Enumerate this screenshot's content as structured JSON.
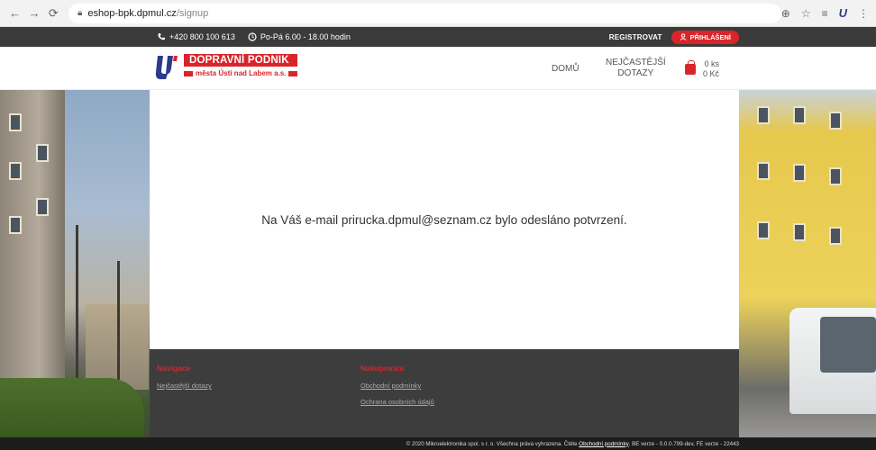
{
  "browser": {
    "url_host": "eshop-bpk.dpmul.cz",
    "url_path": "/signup"
  },
  "topbar": {
    "phone": "+420 800 100 613",
    "hours": "Po-Pá 6.00 - 18.00 hodin",
    "register_label": "REGISTROVAT",
    "login_label": "PŘIHLÁŠENÍ"
  },
  "header": {
    "logo_title": "DOPRAVNÍ PODNIK",
    "logo_subtitle": "města Ústí nad Labem a.s.",
    "nav_home": "DOMŮ",
    "nav_faq_line1": "NEJČASTĚJŠÍ",
    "nav_faq_line2": "DOTAZY",
    "cart_count": "0 ks",
    "cart_price": "0 Kč"
  },
  "main": {
    "message": "Na Váš e-mail prirucka.dpmul@seznam.cz bylo odesláno potvrzení."
  },
  "footer": {
    "nav_heading": "Navigace",
    "nav_links": [
      "Nejčastější dotazy"
    ],
    "shop_heading": "Nakupování",
    "shop_links": [
      "Obchodní podmínky",
      "Ochrana osobních údajů"
    ],
    "copyright_prefix": "© 2020 Mikroelektronika spol. s r. o. Všechna práva vyhrazena. Čtěte",
    "copyright_link": "Obchodní podmínky",
    "copyright_suffix": ". BE verze - 0.0.0.799-dev, FE verze - 22443"
  },
  "colors": {
    "accent": "#d9252a",
    "topbar": "#3b3b3b",
    "footer": "#3d3d3d"
  },
  "icons": [
    "back-arrow-icon",
    "forward-arrow-icon",
    "reload-icon",
    "lock-icon",
    "zoom-icon",
    "star-icon",
    "reading-list-icon",
    "extension-icon",
    "menu-icon",
    "phone-icon",
    "clock-icon",
    "user-icon",
    "cart-icon"
  ]
}
